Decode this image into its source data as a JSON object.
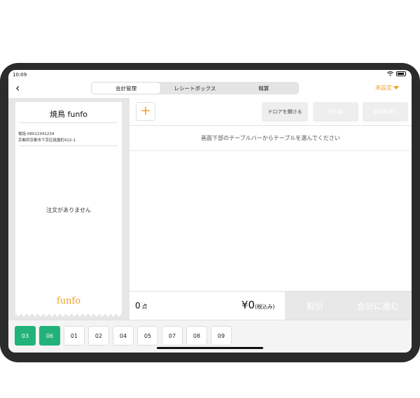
{
  "status": {
    "time": "10:09"
  },
  "nav": {
    "back_icon": "chevron-left-icon",
    "tabs": [
      {
        "label": "会計管理",
        "active": true
      },
      {
        "label": "レシートボックス",
        "active": false
      },
      {
        "label": "精算",
        "active": false
      }
    ],
    "unset_label": "未設定"
  },
  "receipt": {
    "title": "焼鳥 funfo",
    "phone": "電話:08012341234",
    "address": "京都府京都市下京区砥屋町622-1",
    "empty_text": "注文がありません",
    "logo_text": "funfo"
  },
  "toolbar": {
    "add_label": "+",
    "drawer_label": "ドロアを開ける",
    "split_label": "割り勘",
    "reissue_label": "領収書発行"
  },
  "hint": "画面下部のテーブルバーからテーブルを選んでください",
  "summary": {
    "count": "0",
    "count_unit": "点",
    "total": "¥0",
    "tax_note": "(税込み)",
    "discount_label": "割引",
    "proceed_label": "会計に進む"
  },
  "tables": [
    {
      "label": "03",
      "active": true
    },
    {
      "label": "06",
      "active": true
    },
    {
      "label": "01",
      "active": false
    },
    {
      "label": "02",
      "active": false
    },
    {
      "label": "04",
      "active": false
    },
    {
      "label": "05",
      "active": false
    },
    {
      "label": "07",
      "active": false
    },
    {
      "label": "08",
      "active": false
    },
    {
      "label": "09",
      "active": false
    }
  ],
  "colors": {
    "accent": "#f0a020",
    "table_active": "#22b37a"
  }
}
